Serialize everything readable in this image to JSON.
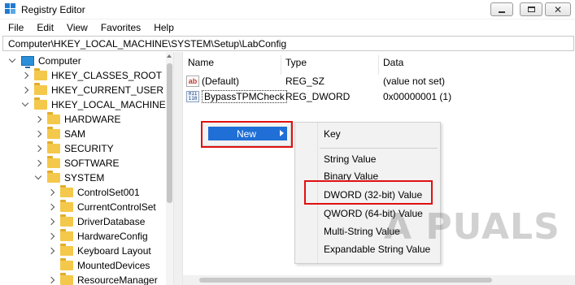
{
  "window": {
    "title": "Registry Editor"
  },
  "menu": [
    "File",
    "Edit",
    "View",
    "Favorites",
    "Help"
  ],
  "address": "Computer\\HKEY_LOCAL_MACHINE\\SYSTEM\\Setup\\LabConfig",
  "tree": {
    "root": "Computer",
    "items": [
      "HKEY_CLASSES_ROOT",
      "HKEY_CURRENT_USER",
      "HKEY_LOCAL_MACHINE",
      "HARDWARE",
      "SAM",
      "SECURITY",
      "SOFTWARE",
      "SYSTEM",
      "ControlSet001",
      "CurrentControlSet",
      "DriverDatabase",
      "HardwareConfig",
      "Keyboard Layout",
      "MountedDevices",
      "ResourceManager"
    ]
  },
  "columns": {
    "name": "Name",
    "type": "Type",
    "data": "Data"
  },
  "values": [
    {
      "name": "(Default)",
      "type": "REG_SZ",
      "data": "(value not set)",
      "icon": "string-value-icon"
    },
    {
      "name": "BypassTPMCheck",
      "type": "REG_DWORD",
      "data": "0x00000001 (1)",
      "icon": "binary-value-icon"
    }
  ],
  "context_menu": {
    "new_label": "New"
  },
  "submenu": {
    "key": "Key",
    "string_value": "String Value",
    "binary_value": "Binary Value",
    "dword_value": "DWORD (32-bit) Value",
    "qword_value": "QWORD (64-bit) Value",
    "multi_string_value": "Multi-String Value",
    "expandable_string_value": "Expandable String Value"
  },
  "watermark": "A PUALS",
  "colors": {
    "highlight": "#1f6fd6",
    "annotation_red": "#e01010",
    "folder": "#f4c84a"
  }
}
